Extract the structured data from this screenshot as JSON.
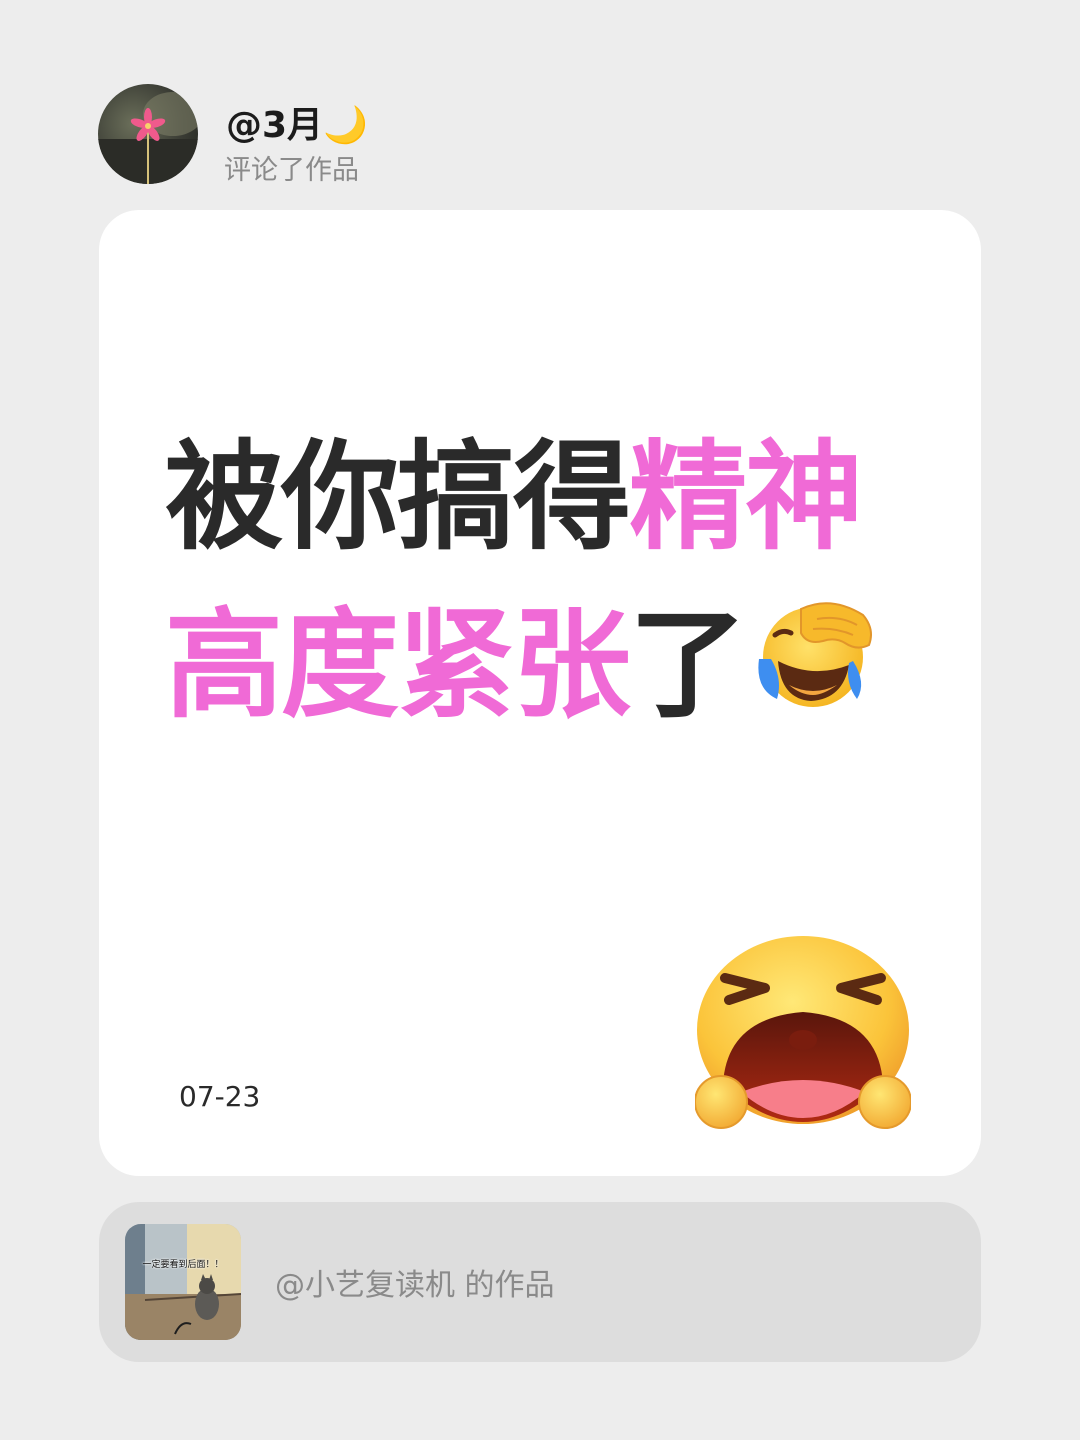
{
  "author": {
    "username": "@3月🌙",
    "action": "评论了作品"
  },
  "comment": {
    "line1_dark": "被你搞得",
    "line1_pink": "精神",
    "line2_pink": "高度紧张",
    "line2_dark": "了",
    "date": "07-23",
    "inline_emoji": "facepalm-laughing-crying-emoji",
    "sticker": "crying-loudly-emoji"
  },
  "work": {
    "label": "@小艺复读机 的作品",
    "thumbnail_caption": "一定要看到后面！！"
  },
  "colors": {
    "background": "#ededed",
    "card": "#ffffff",
    "pink": "#f06ad6",
    "dark": "#2a2a2a",
    "muted": "#8a8a8a",
    "work_card": "#dddddd"
  }
}
